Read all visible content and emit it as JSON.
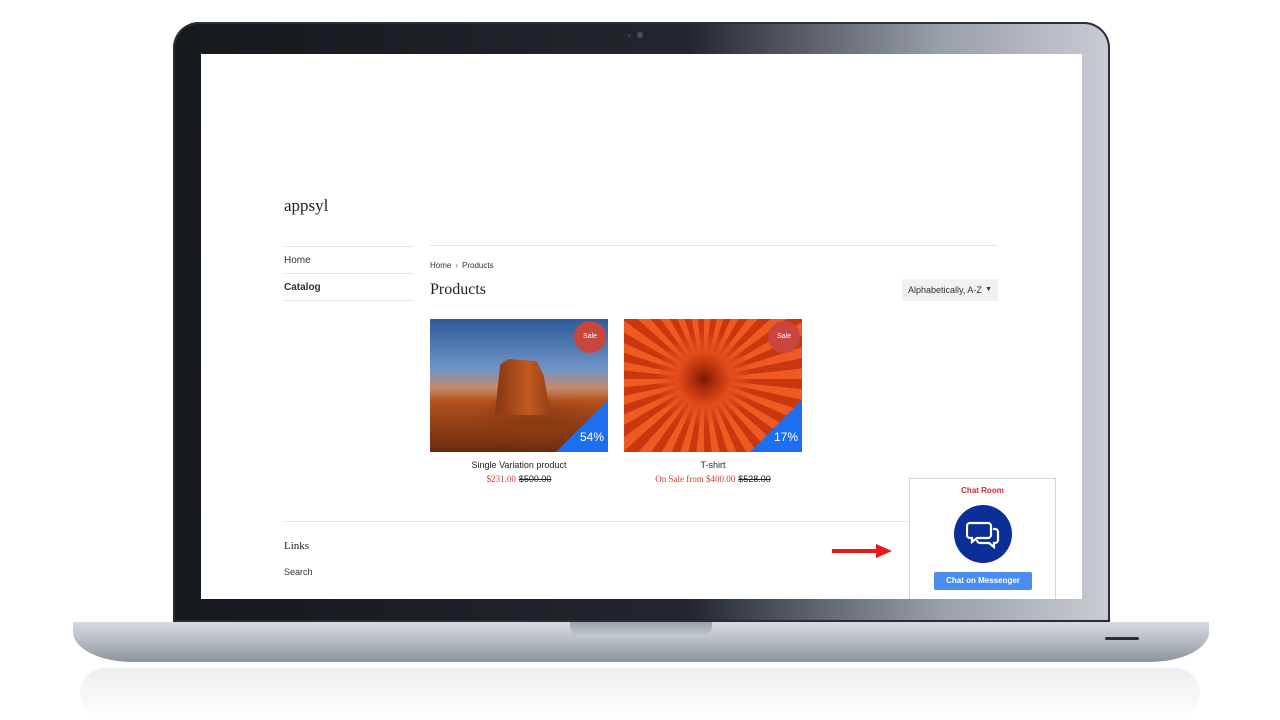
{
  "store": {
    "logo": "appsyl"
  },
  "nav": {
    "items": [
      {
        "label": "Home",
        "active": false
      },
      {
        "label": "Catalog",
        "active": true
      }
    ]
  },
  "breadcrumb": {
    "home": "Home",
    "separator": "›",
    "current": "Products"
  },
  "page": {
    "title": "Products"
  },
  "sort": {
    "selected": "Alphabetically, A-Z"
  },
  "products": [
    {
      "name": "Single Variation product",
      "badge": "Sale",
      "discount": "54%",
      "price": "$231.00",
      "compare_price": "$500.00"
    },
    {
      "name": "T-shirt",
      "badge": "Sale",
      "discount": "17%",
      "price": "On Sale from $400.00",
      "compare_price": "$528.00"
    }
  ],
  "footer": {
    "links_title": "Links",
    "search_link": "Search"
  },
  "chat": {
    "title": "Chat Room",
    "button": "Chat on Messenger",
    "icon": "chat-bubbles-icon"
  },
  "colors": {
    "sale_badge": "#c9463f",
    "discount": "#1d6ff0",
    "sale_price": "#d43a32",
    "chat_title": "#e0262a",
    "chat_icon_bg": "#0b2f96",
    "chat_button": "#4a8df0",
    "arrow": "#e51b1b"
  }
}
